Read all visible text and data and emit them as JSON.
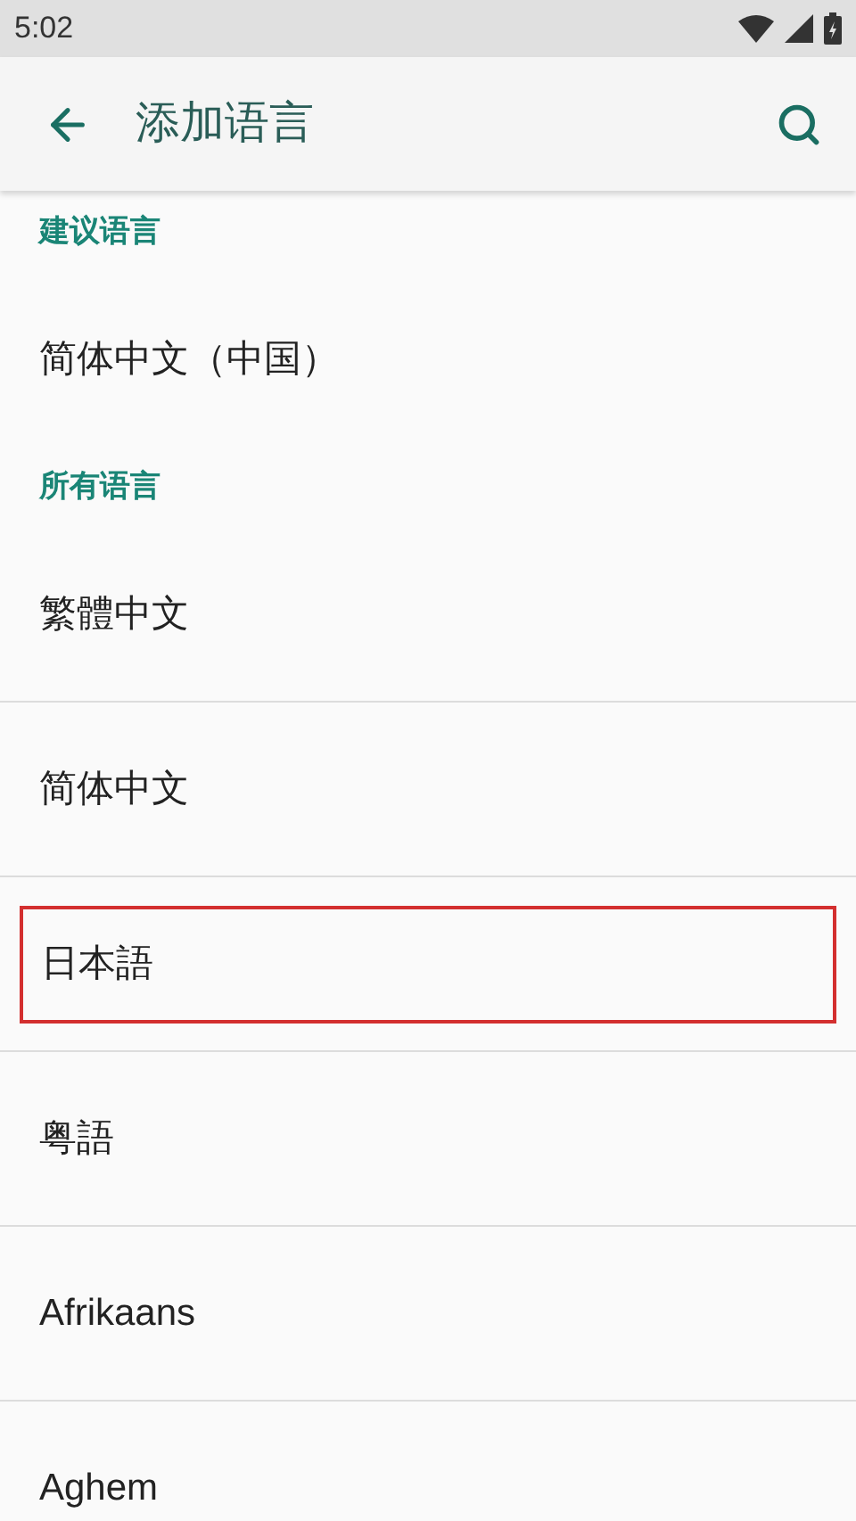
{
  "status_bar": {
    "time": "5:02"
  },
  "app_bar": {
    "title": "添加语言"
  },
  "sections": [
    {
      "header": "建议语言",
      "items": [
        {
          "label": "简体中文（中国）",
          "highlighted": false
        }
      ]
    },
    {
      "header": "所有语言",
      "items": [
        {
          "label": "繁體中文",
          "highlighted": false
        },
        {
          "label": "简体中文",
          "highlighted": false
        },
        {
          "label": "日本語",
          "highlighted": true
        },
        {
          "label": "粤語",
          "highlighted": false
        },
        {
          "label": "Afrikaans",
          "highlighted": false
        },
        {
          "label": "Aghem",
          "highlighted": false
        }
      ]
    }
  ]
}
